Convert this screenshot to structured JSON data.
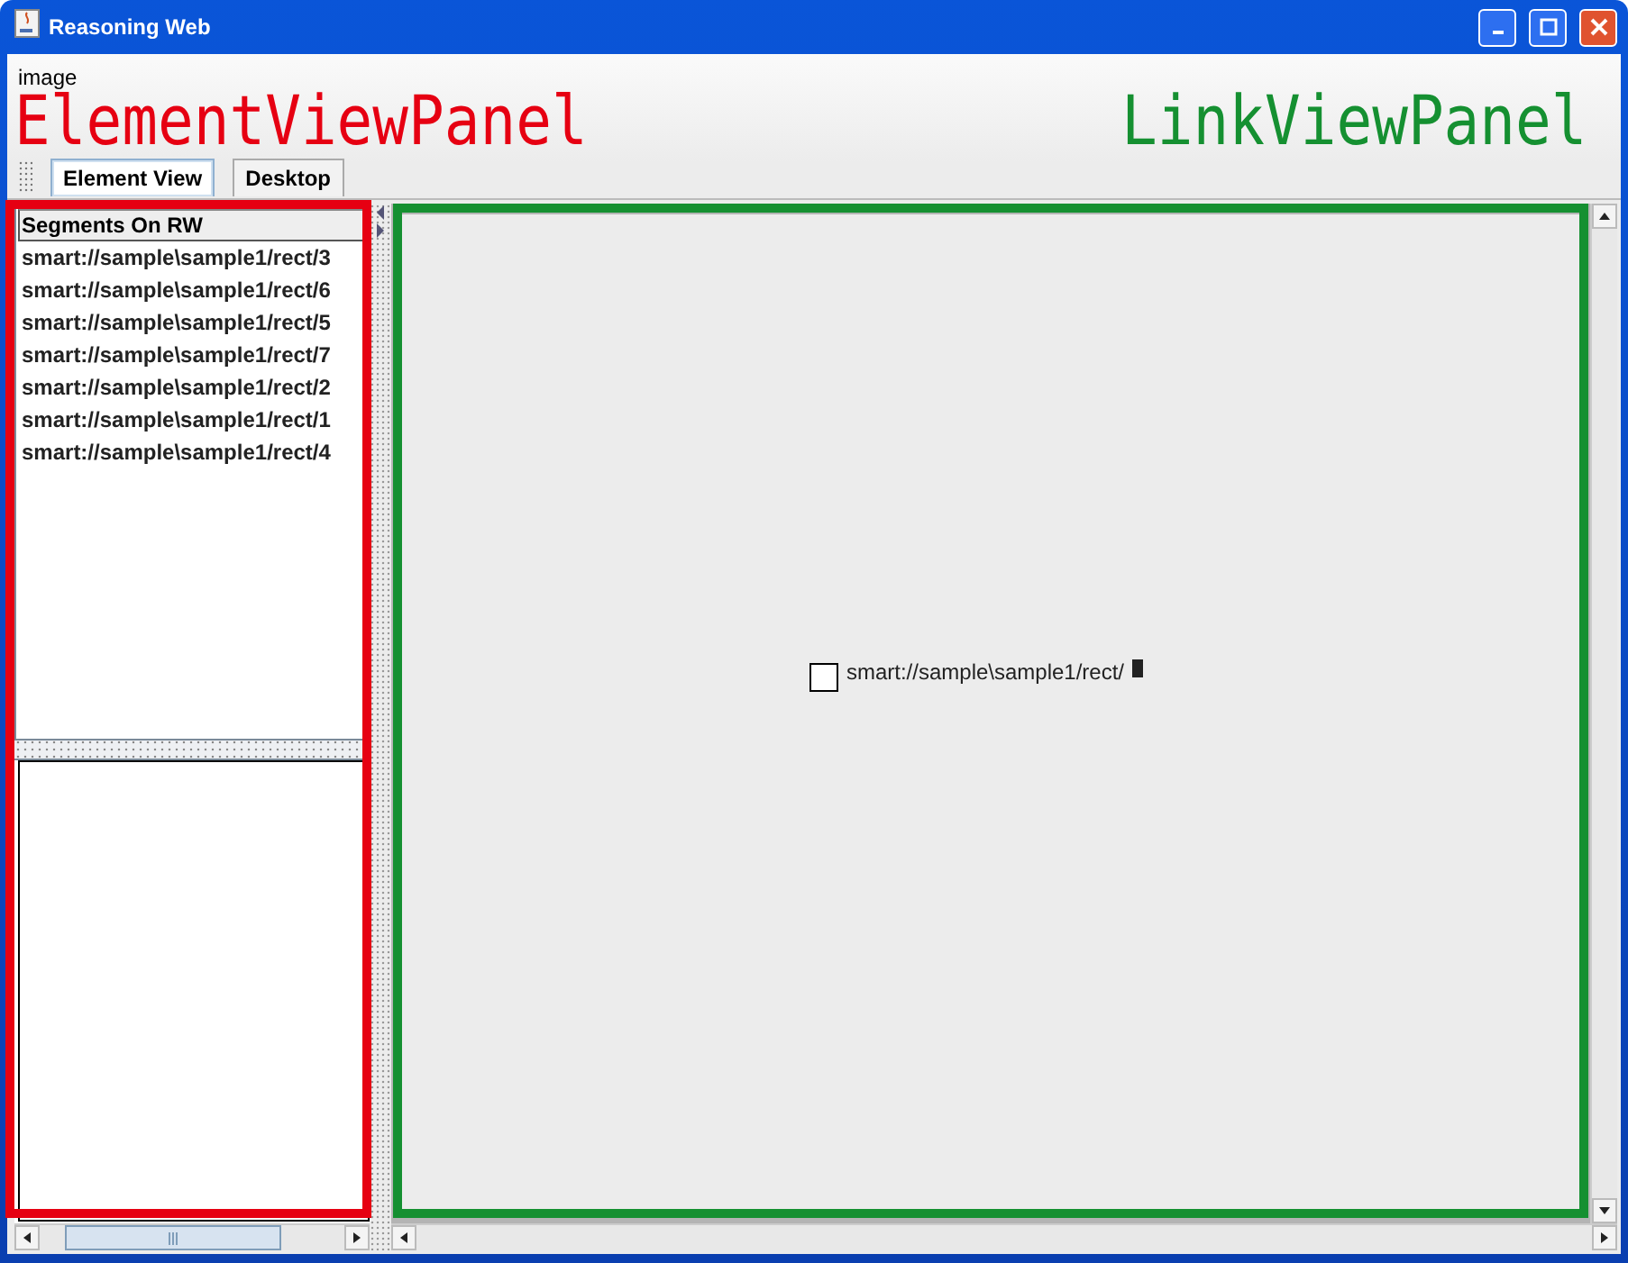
{
  "window": {
    "title": "Reasoning Web"
  },
  "menu": [
    "image"
  ],
  "tabs": [
    {
      "label": "Element View",
      "selected": true
    },
    {
      "label": "Desktop",
      "selected": false
    }
  ],
  "element_view": {
    "list_header": "Segments On RW",
    "items": [
      "smart://sample\\sample1/rect/3",
      "smart://sample\\sample1/rect/6",
      "smart://sample\\sample1/rect/5",
      "smart://sample\\sample1/rect/7",
      "smart://sample\\sample1/rect/2",
      "smart://sample\\sample1/rect/1",
      "smart://sample\\sample1/rect/4"
    ]
  },
  "link_view": {
    "nodes": [
      {
        "label": "smart://sample\\sample1/rect/"
      }
    ]
  },
  "annotations": [
    {
      "label": "ElementViewPanel",
      "color": "#e60012",
      "kind": "left"
    },
    {
      "label": "LinkViewPanel",
      "color": "#159031",
      "kind": "right"
    }
  ]
}
